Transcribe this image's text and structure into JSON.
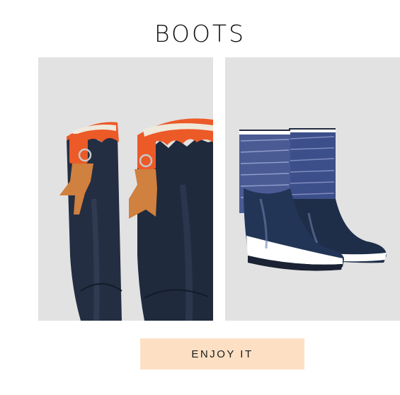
{
  "header": {
    "title": "BOOTS"
  },
  "products": [
    {
      "image": "tall-navy-rain-boots-orange-tassels"
    },
    {
      "image": "short-navy-rain-boots-patterned-shaft"
    }
  ],
  "cta": {
    "label": "ENJOY IT",
    "background": "#fde0c4"
  },
  "colors": {
    "navy": "#232e42",
    "orange": "#ec5a28",
    "tan": "#d0803f"
  }
}
